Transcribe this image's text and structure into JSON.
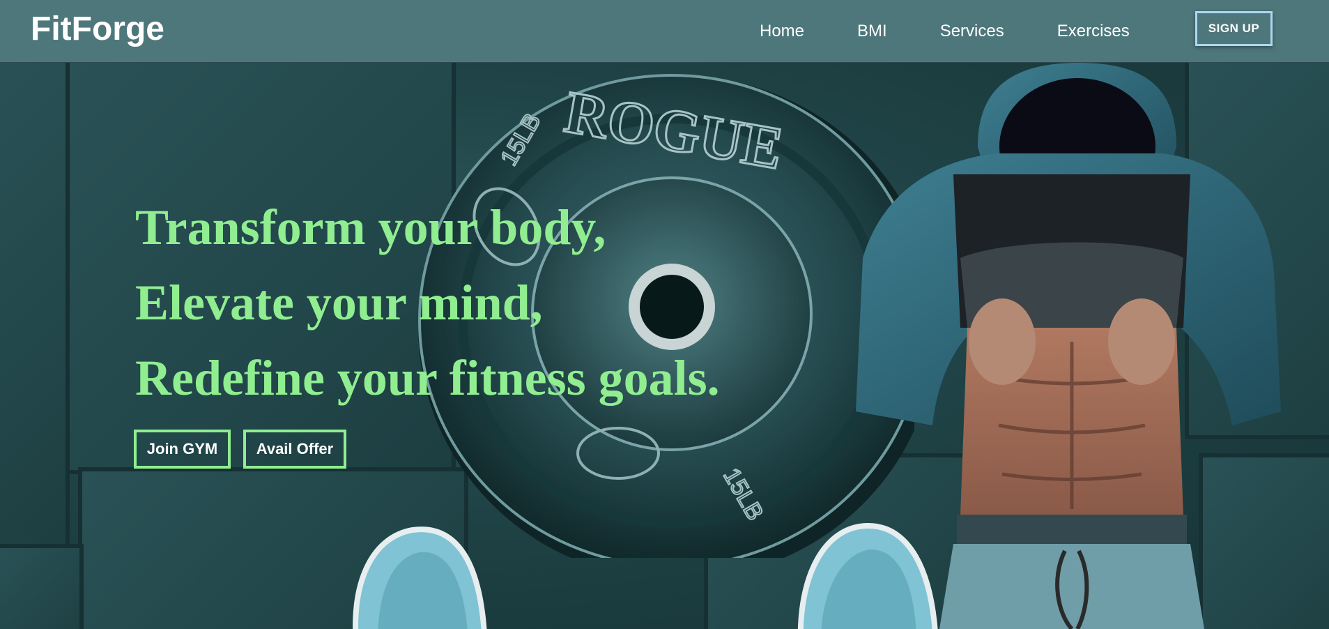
{
  "navbar": {
    "brand": "FitForge",
    "links": [
      {
        "label": "Home"
      },
      {
        "label": "BMI"
      },
      {
        "label": "Services"
      },
      {
        "label": "Exercises"
      }
    ],
    "signup_label": "SIGN UP"
  },
  "hero": {
    "headline": [
      "Transform your body,",
      "Elevate your mind,",
      "Redefine your fitness goals."
    ],
    "buttons": {
      "join_label": "Join GYM",
      "offer_label": "Avail Offer"
    },
    "image": {
      "plate_text": [
        "ROGUE",
        "15LB",
        "15LB",
        "15LB"
      ]
    }
  },
  "colors": {
    "navbar_bg": "#4e777b",
    "headline": "#90ee90",
    "cta_border": "#90ee90",
    "signup_border": "#a9d8f2",
    "text": "#ffffff"
  }
}
